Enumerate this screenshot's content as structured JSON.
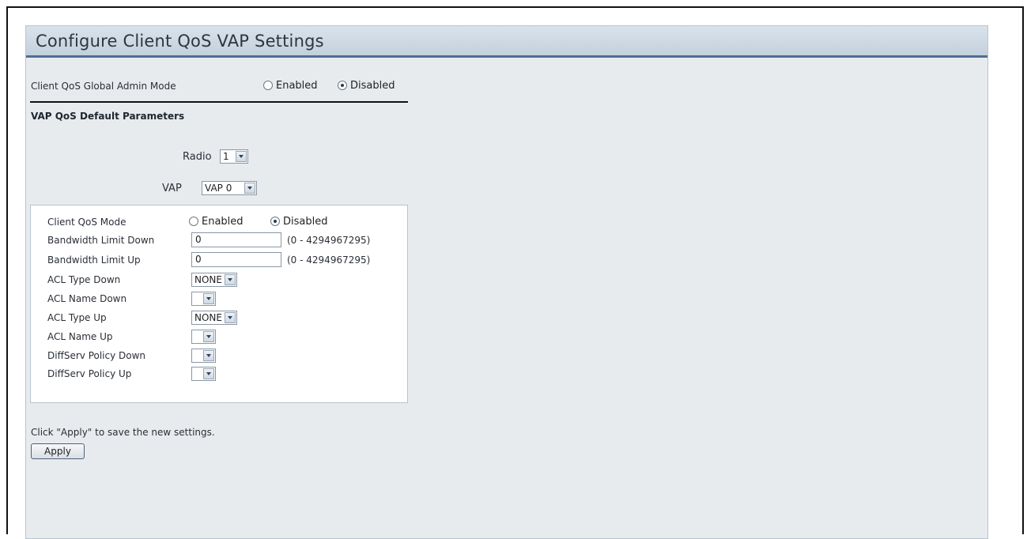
{
  "page": {
    "title": "Configure Client QoS VAP Settings"
  },
  "global_mode": {
    "label": "Client QoS Global Admin Mode",
    "enabled_label": "Enabled",
    "disabled_label": "Disabled",
    "selected": "Disabled"
  },
  "defaults": {
    "heading": "VAP QoS Default Parameters"
  },
  "radio": {
    "label": "Radio",
    "value": "1"
  },
  "vap": {
    "label": "VAP",
    "value": "VAP 0"
  },
  "client_qos_mode": {
    "label": "Client QoS Mode",
    "enabled_label": "Enabled",
    "disabled_label": "Disabled",
    "selected": "Disabled"
  },
  "bandwidth_down": {
    "label": "Bandwidth Limit Down",
    "value": "0",
    "range": "(0 - 4294967295)"
  },
  "bandwidth_up": {
    "label": "Bandwidth Limit Up",
    "value": "0",
    "range": "(0 - 4294967295)"
  },
  "acl_type_down": {
    "label": "ACL Type Down",
    "value": "NONE"
  },
  "acl_name_down": {
    "label": "ACL Name Down",
    "value": ""
  },
  "acl_type_up": {
    "label": "ACL Type Up",
    "value": "NONE"
  },
  "acl_name_up": {
    "label": "ACL Name Up",
    "value": ""
  },
  "diffserv_down": {
    "label": "DiffServ Policy Down",
    "value": ""
  },
  "diffserv_up": {
    "label": "DiffServ Policy Up",
    "value": ""
  },
  "footer": {
    "hint": "Click \"Apply\" to save the new settings.",
    "apply_label": "Apply"
  }
}
